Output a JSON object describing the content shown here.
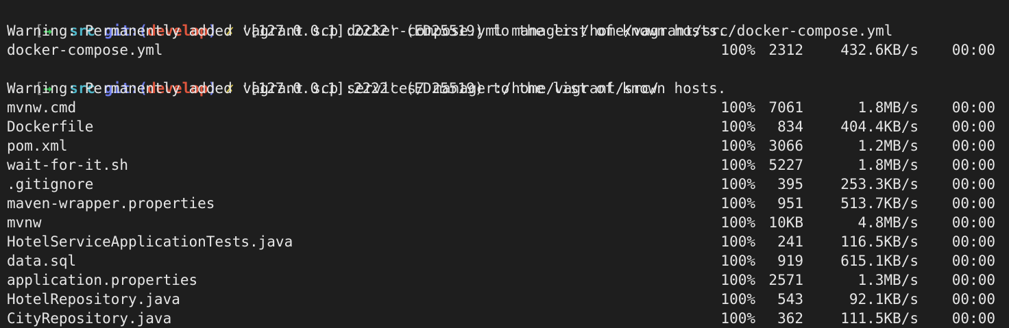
{
  "prompt": {
    "bracket": "[",
    "arrow": "→",
    "dir": "src",
    "git_open": "git:(",
    "branch": "develop",
    "git_close": ")",
    "dirty": "✗"
  },
  "command1": "vagrant scp docker-compose.yml manager:/home/vagrant/src/docker-compose.yml",
  "warning1": "Warning: Permanently added '[127.0.0.1]:2222' (ED25519) to the list of known hosts.",
  "transfer1": [
    {
      "file": "docker-compose.yml",
      "pct": "100%",
      "size": "2312",
      "rate": "432.6KB/s",
      "eta": "00:00"
    }
  ],
  "command2": "vagrant scp services/ manager:/home/vagrant/src/",
  "warning2": "Warning: Permanently added '[127.0.0.1]:2222' (ED25519) to the list of known hosts.",
  "transfer2": [
    {
      "file": "mvnw.cmd",
      "pct": "100%",
      "size": "7061",
      "rate": "1.8MB/s",
      "eta": "00:00"
    },
    {
      "file": "Dockerfile",
      "pct": "100%",
      "size": "834",
      "rate": "404.4KB/s",
      "eta": "00:00"
    },
    {
      "file": "pom.xml",
      "pct": "100%",
      "size": "3066",
      "rate": "1.2MB/s",
      "eta": "00:00"
    },
    {
      "file": "wait-for-it.sh",
      "pct": "100%",
      "size": "5227",
      "rate": "1.8MB/s",
      "eta": "00:00"
    },
    {
      "file": ".gitignore",
      "pct": "100%",
      "size": "395",
      "rate": "253.3KB/s",
      "eta": "00:00"
    },
    {
      "file": "maven-wrapper.properties",
      "pct": "100%",
      "size": "951",
      "rate": "513.7KB/s",
      "eta": "00:00"
    },
    {
      "file": "mvnw",
      "pct": "100%",
      "size": "10KB",
      "rate": "4.8MB/s",
      "eta": "00:00"
    },
    {
      "file": "HotelServiceApplicationTests.java",
      "pct": "100%",
      "size": "241",
      "rate": "116.5KB/s",
      "eta": "00:00"
    },
    {
      "file": "data.sql",
      "pct": "100%",
      "size": "919",
      "rate": "615.1KB/s",
      "eta": "00:00"
    },
    {
      "file": "application.properties",
      "pct": "100%",
      "size": "2571",
      "rate": "1.3MB/s",
      "eta": "00:00"
    },
    {
      "file": "HotelRepository.java",
      "pct": "100%",
      "size": "543",
      "rate": "92.1KB/s",
      "eta": "00:00"
    },
    {
      "file": "CityRepository.java",
      "pct": "100%",
      "size": "362",
      "rate": "111.5KB/s",
      "eta": "00:00"
    }
  ],
  "colors": {
    "background": "#1e1e1e",
    "text": "#e6e6e6",
    "arrow": "#3fc95b",
    "dir": "#4fb7c9",
    "git": "#6b79e8",
    "branch": "#e0563e",
    "dirty": "#d4c24a"
  }
}
